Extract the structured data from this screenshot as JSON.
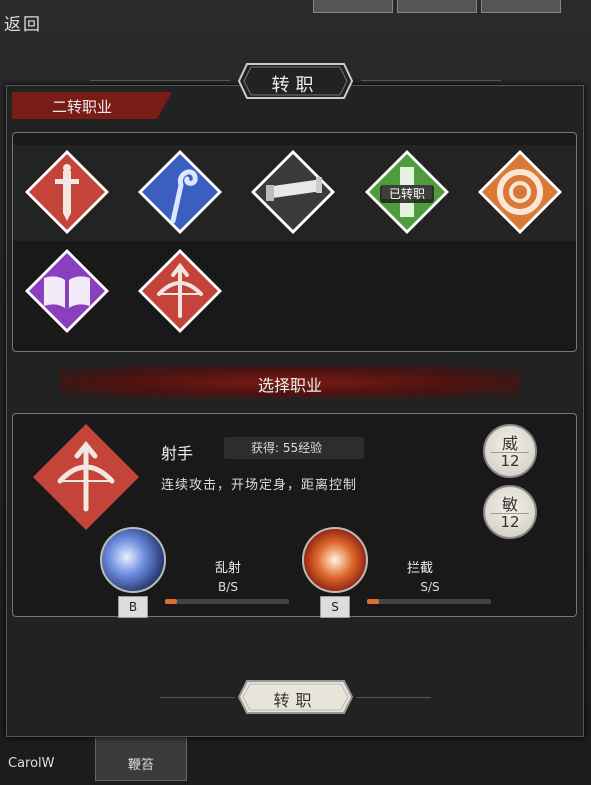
{
  "nav": {
    "back_label": "返回"
  },
  "panel": {
    "title": "转职"
  },
  "section": {
    "label": "二转职业"
  },
  "classes": [
    {
      "icon": "sword-icon",
      "color": "#c4443a"
    },
    {
      "icon": "staff-icon",
      "color": "#3a5fbf"
    },
    {
      "icon": "telescope-icon",
      "color": "#3a3a3a"
    },
    {
      "icon": "cross-icon",
      "color": "#4e9c3c",
      "badge": "已转职"
    },
    {
      "icon": "target-icon",
      "color": "#d9793a"
    },
    {
      "icon": "book-icon",
      "color": "#8a3fbf"
    },
    {
      "icon": "bow-icon",
      "color": "#c4443a"
    }
  ],
  "choose_label": "选择职业",
  "selected": {
    "name": "射手",
    "exp": "获得: 55经验",
    "description": "连续攻击，开场定身，距离控制",
    "icon": "bow-icon",
    "stats": [
      {
        "name": "威",
        "value": "12"
      },
      {
        "name": "敏",
        "value": "12"
      }
    ],
    "skills": [
      {
        "name": "乱射",
        "grade": "B/S",
        "rank": "B",
        "icon": "burst-icon",
        "progress": 0.1
      },
      {
        "name": "拦截",
        "grade": "S/S",
        "rank": "S",
        "icon": "flame-swirl-icon",
        "progress": 0.1
      }
    ]
  },
  "confirm_button": "转职",
  "background": {
    "tabs": [
      "",
      "",
      ""
    ],
    "carol_label": "CarolW",
    "whip_label": "鞭笞"
  },
  "colors": {
    "accent_red": "#c4443a",
    "panel": "#222222",
    "progress": "#e0702a"
  }
}
